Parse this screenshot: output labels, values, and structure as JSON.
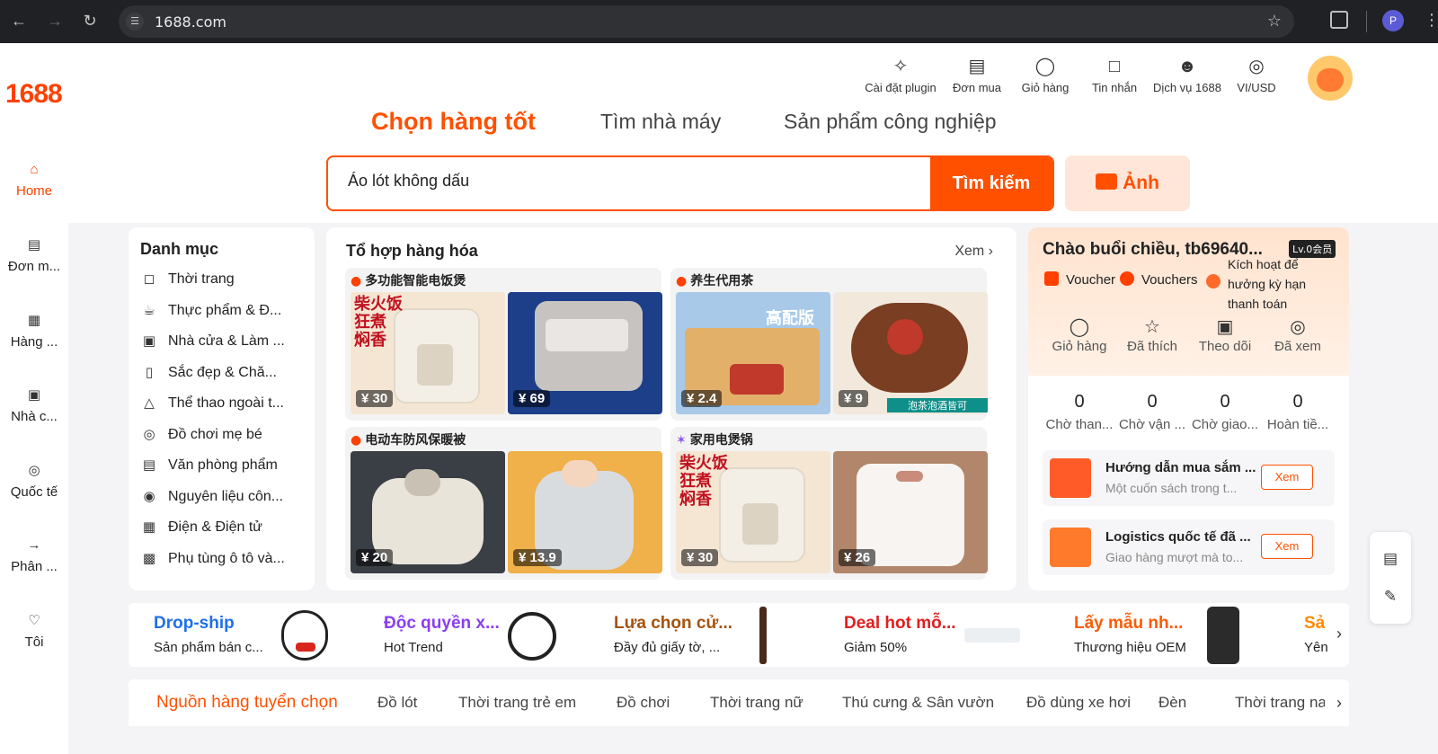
{
  "browser": {
    "url": "1688.com",
    "profile_initial": "P"
  },
  "logo": "1688",
  "sidebar": {
    "items": [
      {
        "label": "Home",
        "icon": "home-icon"
      },
      {
        "label": "Đơn m...",
        "icon": "order-icon"
      },
      {
        "label": "Hàng ...",
        "icon": "grid-icon"
      },
      {
        "label": "Nhà c...",
        "icon": "factory-icon"
      },
      {
        "label": "Quốc tế",
        "icon": "globe-icon"
      },
      {
        "label": "Phân ...",
        "icon": "distribution-icon"
      },
      {
        "label": "Tôi",
        "icon": "user-icon"
      }
    ]
  },
  "toolbar": {
    "items": [
      {
        "label": "Cài đặt plugin",
        "icon": "puzzle-icon"
      },
      {
        "label": "Đơn mua",
        "icon": "clipboard-icon"
      },
      {
        "label": "Giỏ hàng",
        "icon": "cart-icon"
      },
      {
        "label": "Tin nhắn",
        "icon": "message-icon"
      },
      {
        "label": "Dịch vụ 1688",
        "icon": "person-icon"
      },
      {
        "label": "VI/USD",
        "icon": "globe-icon"
      }
    ]
  },
  "tabs": [
    {
      "label": "Chọn hàng tốt",
      "active": true
    },
    {
      "label": "Tìm nhà máy",
      "active": false
    },
    {
      "label": "Sản phẩm công nghiệp",
      "active": false
    }
  ],
  "search": {
    "value": "Áo lót không dấu",
    "button": "Tìm kiếm",
    "photo_button": "Ảnh"
  },
  "categories": {
    "title": "Danh mục",
    "items": [
      {
        "label": "Thời trang",
        "icon": "shirt-icon"
      },
      {
        "label": "Thực phẩm & Đ...",
        "icon": "cup-icon"
      },
      {
        "label": "Nhà cửa & Làm ...",
        "icon": "sofa-icon"
      },
      {
        "label": "Sắc đẹp & Chă...",
        "icon": "cosmetics-icon"
      },
      {
        "label": "Thể thao ngoài t...",
        "icon": "tent-icon"
      },
      {
        "label": "Đồ chơi mẹ bé",
        "icon": "ball-icon"
      },
      {
        "label": "Văn phòng phẩm",
        "icon": "bag-icon"
      },
      {
        "label": "Nguyên liệu côn...",
        "icon": "material-icon"
      },
      {
        "label": "Điện & Điện tử",
        "icon": "chip-icon"
      },
      {
        "label": "Phụ tùng ô tô và...",
        "icon": "car-icon"
      }
    ]
  },
  "combo": {
    "title": "Tổ hợp hàng hóa",
    "more": "Xem",
    "groups": [
      {
        "title": "多功能智能电饭煲",
        "badge": "fire",
        "products": [
          {
            "price": "¥ 30",
            "tag": "柴火饭 狂煮 焖香"
          },
          {
            "price": "¥ 69",
            "tag": ""
          }
        ]
      },
      {
        "title": "养生代用茶",
        "badge": "fire",
        "products": [
          {
            "price": "¥ 2.4",
            "tag": "高配版"
          },
          {
            "price": "¥ 9",
            "tag": "泡茶泡酒皆可"
          }
        ]
      },
      {
        "title": "电动车防风保暖被",
        "badge": "fire",
        "products": [
          {
            "price": "¥ 20",
            "tag": ""
          },
          {
            "price": "¥ 13.9",
            "tag": ""
          }
        ]
      },
      {
        "title": "家用电煲锅",
        "badge": "star",
        "products": [
          {
            "price": "¥ 30",
            "tag": "柴火饭 狂煮 焖香"
          },
          {
            "price": "¥ 26",
            "tag": ""
          }
        ]
      }
    ]
  },
  "account": {
    "greeting": "Chào buổi chiều,  tb69640...",
    "level": "Lv.0会员",
    "voucher1": "Voucher",
    "voucher2": "Vouchers",
    "credit": "Kích hoạt để hưởng kỳ hạn thanh toán",
    "quick": [
      {
        "label": "Giỏ hàng",
        "icon": "cart-icon"
      },
      {
        "label": "Đã thích",
        "icon": "star-icon"
      },
      {
        "label": "Theo dõi",
        "icon": "shop-icon"
      },
      {
        "label": "Đã xem",
        "icon": "footprint-icon"
      }
    ],
    "stats": [
      {
        "value": "0",
        "label": "Chờ than..."
      },
      {
        "value": "0",
        "label": "Chờ vận ..."
      },
      {
        "value": "0",
        "label": "Chờ giao..."
      },
      {
        "value": "0",
        "label": "Hoàn tiề..."
      }
    ],
    "infos": [
      {
        "title": "Hướng dẫn mua sắm ...",
        "sub": "Một cuốn sách trong t...",
        "button": "Xem"
      },
      {
        "title": "Logistics quốc tế đã ...",
        "sub": "Giao hàng mượt mà to...",
        "button": "Xem"
      }
    ]
  },
  "promos": [
    {
      "title": "Drop-ship",
      "sub": "Sản phẩm bán c...",
      "color": "#1f6feb"
    },
    {
      "title": "Độc quyền x...",
      "sub": "Hot Trend",
      "color": "#8a3ff0"
    },
    {
      "title": "Lựa chọn cử...",
      "sub": "Đầy đủ giấy tờ, ...",
      "color": "#a5520d"
    },
    {
      "title": "Deal hot mỗ...",
      "sub": "Giảm 50%",
      "color": "#e01e1e"
    },
    {
      "title": "Lấy mẫu nh...",
      "sub": "Thương hiệu OEM",
      "color": "#ff5a00"
    },
    {
      "title": "Sả",
      "sub": "Yên",
      "color": "#ff8a00"
    }
  ],
  "category_tabs": [
    {
      "label": "Nguồn hàng tuyển chọn",
      "active": true
    },
    {
      "label": "Đồ lót",
      "active": false
    },
    {
      "label": "Thời trang trẻ em",
      "active": false
    },
    {
      "label": "Đồ chơi",
      "active": false
    },
    {
      "label": "Thời trang nữ",
      "active": false
    },
    {
      "label": "Thú cưng & Sân vườn",
      "active": false
    },
    {
      "label": "Đồ dùng xe hơi",
      "active": false
    },
    {
      "label": "Đèn",
      "active": false
    },
    {
      "label": "Thời trang na",
      "active": false
    }
  ],
  "colors": {
    "accent": "#ff5000",
    "accent_light": "#ffe6d9"
  }
}
